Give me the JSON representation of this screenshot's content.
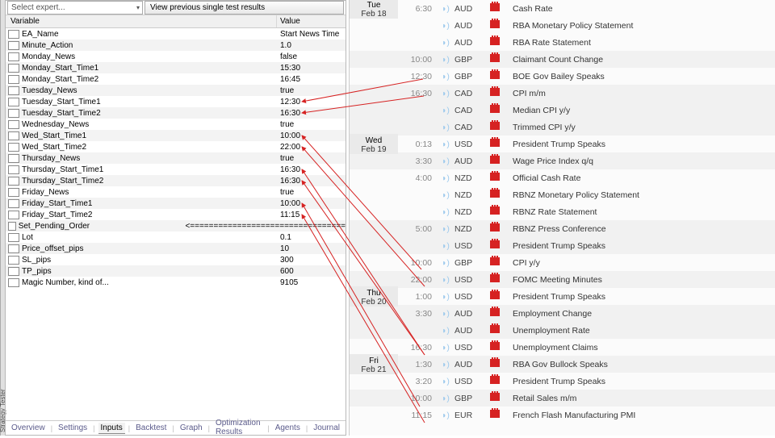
{
  "topbar": {
    "select_expert": "Select expert...",
    "view_button": "View previous single test results"
  },
  "headers": {
    "variable": "Variable",
    "value": "Value"
  },
  "variables": [
    {
      "name": "EA_Name",
      "value": "Start News Time"
    },
    {
      "name": "Minute_Action",
      "value": "1.0"
    },
    {
      "name": "Monday_News",
      "value": "false"
    },
    {
      "name": "Monday_Start_Time1",
      "value": "15:30"
    },
    {
      "name": "Monday_Start_Time2",
      "value": "16:45"
    },
    {
      "name": "Tuesday_News",
      "value": "true"
    },
    {
      "name": "Tuesday_Start_Time1",
      "value": "12:30"
    },
    {
      "name": "Tuesday_Start_Time2",
      "value": "16:30"
    },
    {
      "name": "Wednesday_News",
      "value": "true"
    },
    {
      "name": "Wed_Start_Time1",
      "value": "10:00"
    },
    {
      "name": "Wed_Start_Time2",
      "value": "22:00"
    },
    {
      "name": "Thursday_News",
      "value": "true"
    },
    {
      "name": "Thursday_Start_Time1",
      "value": "16:30"
    },
    {
      "name": "Thursday_Start_Time2",
      "value": "16:30"
    },
    {
      "name": "Friday_News",
      "value": "true"
    },
    {
      "name": "Friday_Start_Time1",
      "value": "10:00"
    },
    {
      "name": "Friday_Start_Time2",
      "value": "11:15"
    },
    {
      "name": "Set_Pending_Order",
      "value": "<================================="
    },
    {
      "name": "Lot",
      "value": "0.1"
    },
    {
      "name": "Price_offset_pips",
      "value": "10"
    },
    {
      "name": "SL_pips",
      "value": "300"
    },
    {
      "name": "TP_pips",
      "value": "600"
    },
    {
      "name": "Magic Number, kind of...",
      "value": "9105"
    }
  ],
  "tabs": [
    "Overview",
    "Settings",
    "Inputs",
    "Backtest",
    "Graph",
    "Optimization Results",
    "Agents",
    "Journal"
  ],
  "active_tab": "Inputs",
  "vert_tab": "Strategy Tester",
  "calendar": [
    {
      "date_day": "Tue",
      "date_mo": "Feb 18",
      "time": "6:30",
      "cur": "AUD",
      "event": "Cash Rate"
    },
    {
      "time": "",
      "cur": "AUD",
      "event": "RBA Monetary Policy Statement"
    },
    {
      "time": "",
      "cur": "AUD",
      "event": "RBA Rate Statement"
    },
    {
      "time": "10:00",
      "cur": "GBP",
      "event": "Claimant Count Change",
      "alt": true
    },
    {
      "time": "12:30",
      "cur": "GBP",
      "event": "BOE Gov Bailey Speaks"
    },
    {
      "time": "16:30",
      "cur": "CAD",
      "event": "CPI m/m",
      "alt": true
    },
    {
      "time": "",
      "cur": "CAD",
      "event": "Median CPI y/y",
      "alt": true
    },
    {
      "time": "",
      "cur": "CAD",
      "event": "Trimmed CPI y/y",
      "alt": true
    },
    {
      "date_day": "Wed",
      "date_mo": "Feb 19",
      "time": "0:13",
      "cur": "USD",
      "event": "President Trump Speaks",
      "dalt": true
    },
    {
      "time": "3:30",
      "cur": "AUD",
      "event": "Wage Price Index q/q",
      "alt": true
    },
    {
      "time": "4:00",
      "cur": "NZD",
      "event": "Official Cash Rate"
    },
    {
      "time": "",
      "cur": "NZD",
      "event": "RBNZ Monetary Policy Statement"
    },
    {
      "time": "",
      "cur": "NZD",
      "event": "RBNZ Rate Statement"
    },
    {
      "time": "5:00",
      "cur": "NZD",
      "event": "RBNZ Press Conference",
      "alt": true
    },
    {
      "time": "",
      "cur": "USD",
      "event": "President Trump Speaks",
      "alt": true
    },
    {
      "time": "10:00",
      "cur": "GBP",
      "event": "CPI y/y"
    },
    {
      "time": "22:00",
      "cur": "USD",
      "event": "FOMC Meeting Minutes",
      "alt": true
    },
    {
      "date_day": "Thu",
      "date_mo": "Feb 20",
      "time": "1:00",
      "cur": "USD",
      "event": "President Trump Speaks",
      "dalt": true
    },
    {
      "time": "3:30",
      "cur": "AUD",
      "event": "Employment Change",
      "alt": true
    },
    {
      "time": "",
      "cur": "AUD",
      "event": "Unemployment Rate",
      "alt": true
    },
    {
      "time": "16:30",
      "cur": "USD",
      "event": "Unemployment Claims"
    },
    {
      "date_day": "Fri",
      "date_mo": "Feb 21",
      "time": "1:30",
      "cur": "AUD",
      "event": "RBA Gov Bullock Speaks",
      "alt": true,
      "dalt": true
    },
    {
      "time": "3:20",
      "cur": "USD",
      "event": "President Trump Speaks"
    },
    {
      "time": "10:00",
      "cur": "GBP",
      "event": "Retail Sales m/m",
      "alt": true
    },
    {
      "time": "11:15",
      "cur": "EUR",
      "event": "French Flash Manufacturing PMI"
    }
  ]
}
